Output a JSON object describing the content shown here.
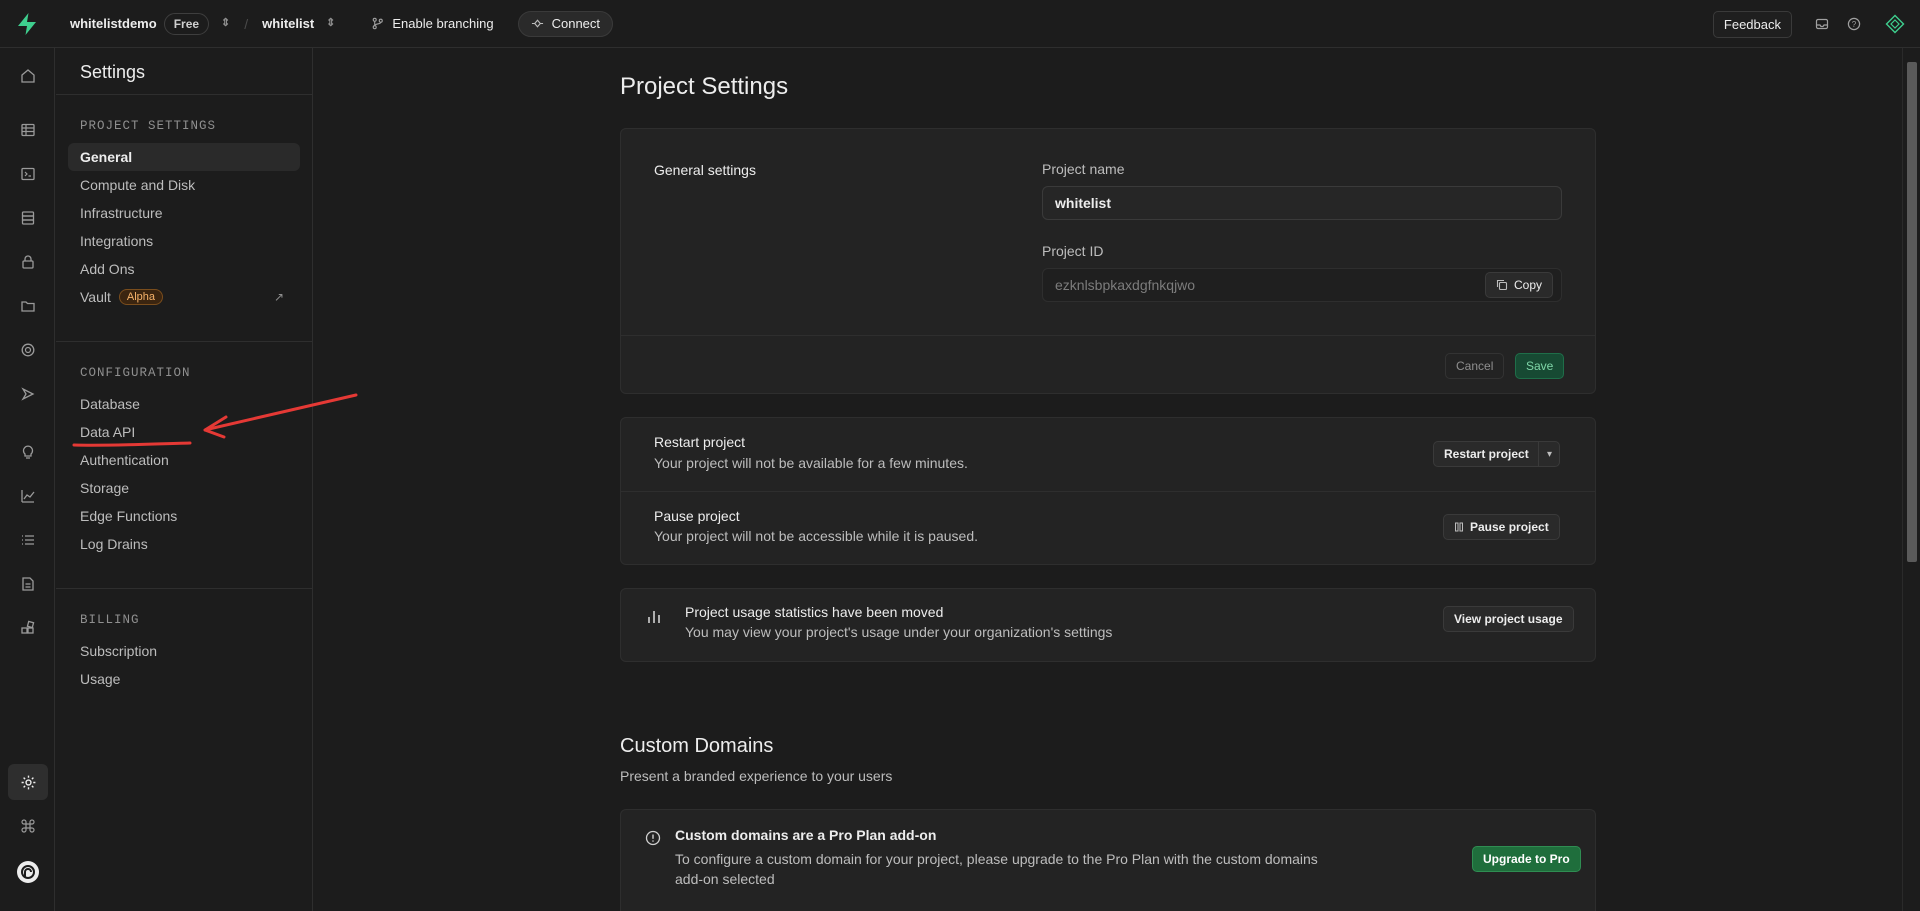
{
  "topbar": {
    "org_name": "whitelistdemo",
    "plan_badge": "Free",
    "project_name": "whitelist",
    "enable_branching": "Enable branching",
    "connect": "Connect",
    "feedback": "Feedback"
  },
  "sidebar": {
    "title": "Settings",
    "sections": [
      {
        "heading": "PROJECT SETTINGS",
        "items": [
          "General",
          "Compute and Disk",
          "Infrastructure",
          "Integrations",
          "Add Ons",
          "Vault"
        ]
      },
      {
        "heading": "CONFIGURATION",
        "items": [
          "Database",
          "Data API",
          "Authentication",
          "Storage",
          "Edge Functions",
          "Log Drains"
        ]
      },
      {
        "heading": "BILLING",
        "items": [
          "Subscription",
          "Usage"
        ]
      }
    ],
    "vault_badge": "Alpha",
    "active_item": "General"
  },
  "main": {
    "page_title": "Project Settings",
    "general": {
      "label": "General settings",
      "project_name_label": "Project name",
      "project_name_value": "whitelist",
      "project_id_label": "Project ID",
      "project_id_value": "ezknlsbpkaxdgfnkqjwo",
      "copy": "Copy",
      "cancel": "Cancel",
      "save": "Save"
    },
    "restart": {
      "title": "Restart project",
      "desc": "Your project will not be available for a few minutes.",
      "button": "Restart project"
    },
    "pause": {
      "title": "Pause project",
      "desc": "Your project will not be accessible while it is paused.",
      "button": "Pause project"
    },
    "usage": {
      "title": "Project usage statistics have been moved",
      "desc": "You may view your project's usage under your organization's settings",
      "button": "View project usage"
    },
    "custom_domains": {
      "title": "Custom Domains",
      "subtitle": "Present a branded experience to your users",
      "notice_title": "Custom domains are a Pro Plan add-on",
      "notice_desc_line1": "To configure a custom domain for your project, please upgrade to the Pro Plan with the custom domains",
      "notice_desc_line2": "add-on selected",
      "button": "Upgrade to Pro"
    }
  },
  "colors": {
    "brand": "#3ecf8e",
    "annotation": "#e53935"
  }
}
